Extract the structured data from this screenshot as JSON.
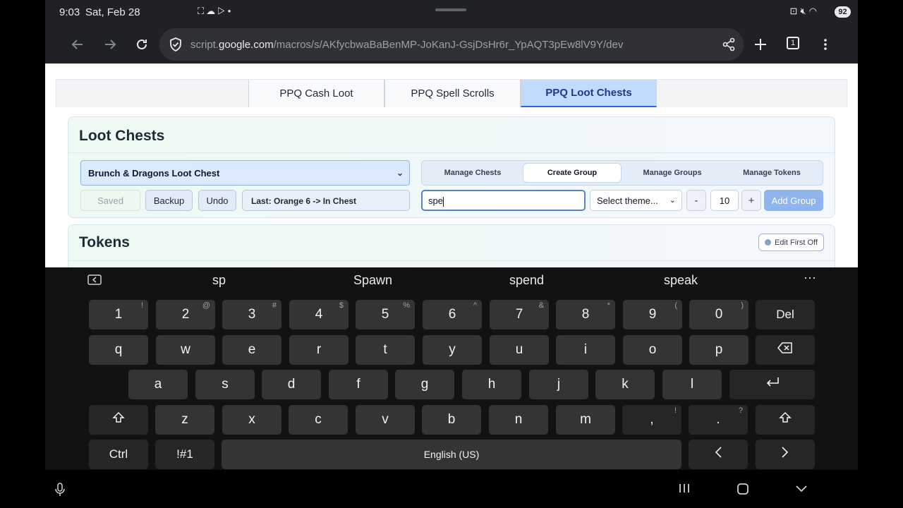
{
  "status_bar": {
    "time": "9:03",
    "date": "Sat, Feb 28",
    "battery": "92"
  },
  "browser": {
    "url_prefix": "script.",
    "url_domain": "google.com",
    "url_path": "/macros/s/AKfycbwaBaBenMP-JoKanJ-GsjDsHr6r_YpAQT3pEw8lV9Y/dev",
    "tab_count": "1"
  },
  "page": {
    "tabs": [
      {
        "label": "PPQ Cash Loot"
      },
      {
        "label": "PPQ Spell Scrolls"
      },
      {
        "label": "PPQ Loot Chests"
      }
    ],
    "loot_card": {
      "title": "Loot Chests",
      "chest_select": "Brunch & Dragons Loot Chest",
      "saved_label": "Saved",
      "backup_label": "Backup",
      "undo_label": "Undo",
      "last_action": "Last: Orange 6 -> In Chest",
      "segments": [
        {
          "label": "Manage Chests"
        },
        {
          "label": "Create Group"
        },
        {
          "label": "Manage Groups"
        },
        {
          "label": "Manage Tokens"
        }
      ],
      "group_name_value": "spe",
      "theme_select": "Select theme...",
      "minus_label": "-",
      "quantity": "10",
      "plus_label": "+",
      "add_group_label": "Add Group"
    },
    "tokens_card": {
      "title": "Tokens",
      "edit_first_off": "Edit First Off"
    }
  },
  "keyboard": {
    "suggestions": [
      "sp",
      "Spawn",
      "spend",
      "speak"
    ],
    "row1": [
      {
        "k": "1",
        "s": "!"
      },
      {
        "k": "2",
        "s": "@"
      },
      {
        "k": "3",
        "s": "#"
      },
      {
        "k": "4",
        "s": "$"
      },
      {
        "k": "5",
        "s": "%"
      },
      {
        "k": "6",
        "s": "^"
      },
      {
        "k": "7",
        "s": "&"
      },
      {
        "k": "8",
        "s": "*"
      },
      {
        "k": "9",
        "s": "("
      },
      {
        "k": "0",
        "s": ")"
      }
    ],
    "del_label": "Del",
    "row2": [
      "q",
      "w",
      "e",
      "r",
      "t",
      "y",
      "u",
      "i",
      "o",
      "p"
    ],
    "row3": [
      "a",
      "s",
      "d",
      "f",
      "g",
      "h",
      "j",
      "k",
      "l"
    ],
    "row4": [
      "z",
      "x",
      "c",
      "v",
      "b",
      "n",
      "m"
    ],
    "comma": {
      "k": ",",
      "s": "!"
    },
    "period": {
      "k": ".",
      "s": "?"
    },
    "ctrl_label": "Ctrl",
    "symbols_label": "!#1",
    "space_label": "English (US)"
  }
}
